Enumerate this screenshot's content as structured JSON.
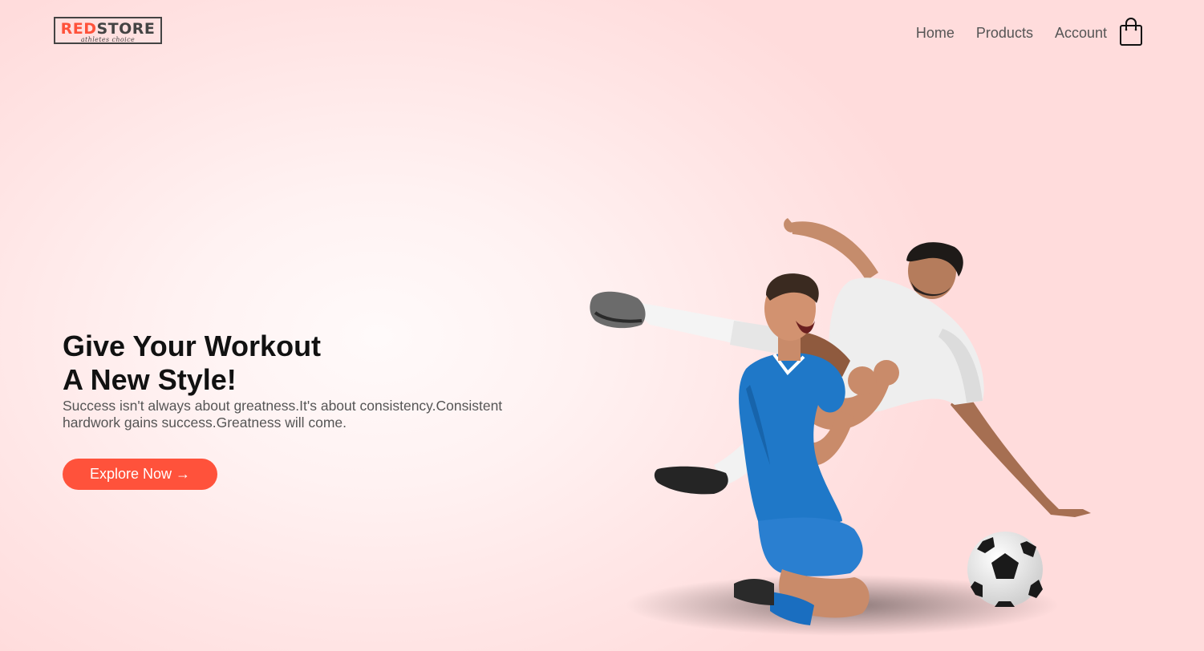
{
  "brand": {
    "name_part_red": "RED",
    "name_part_dark": "STORE",
    "tagline": "athletes choice",
    "accent_color": "#ff523b"
  },
  "nav": {
    "items": [
      {
        "label": "Home"
      },
      {
        "label": "Products"
      },
      {
        "label": "Account"
      }
    ],
    "cart_icon": "shopping-bag-icon"
  },
  "hero": {
    "title_line1": "Give Your Workout",
    "title_line2": "A New Style!",
    "description": "Success isn't always about greatness.It's about consistency.Consistent hardwork gains success.Greatness will come.",
    "button_label": "Explore Now →",
    "image_subject": "two soccer players celebrating with a football"
  }
}
